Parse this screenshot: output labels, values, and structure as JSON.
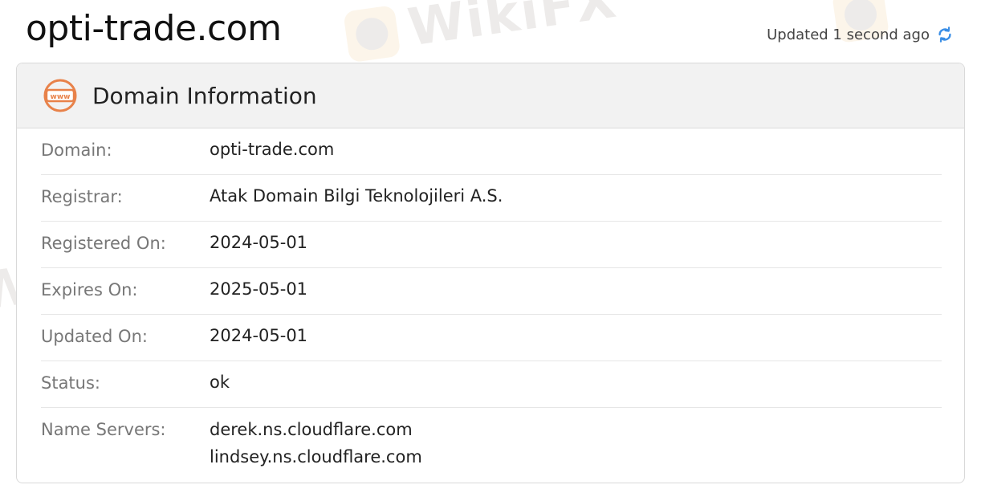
{
  "header": {
    "domain_title": "opti-trade.com",
    "updated_text": "Updated 1 second ago",
    "refresh_icon": "refresh-icon"
  },
  "card": {
    "title": "Domain Information",
    "icon": "www-icon",
    "icon_text": "www",
    "rows": [
      {
        "label": "Domain:",
        "value": "opti-trade.com"
      },
      {
        "label": "Registrar:",
        "value": "Atak Domain Bilgi Teknolojileri A.S."
      },
      {
        "label": "Registered On:",
        "value": "2024-05-01"
      },
      {
        "label": "Expires On:",
        "value": "2025-05-01"
      },
      {
        "label": "Updated On:",
        "value": "2024-05-01"
      },
      {
        "label": "Status:",
        "value": "ok"
      },
      {
        "label": "Name Servers:",
        "values": [
          "derek.ns.cloudflare.com",
          "lindsey.ns.cloudflare.com"
        ]
      }
    ]
  },
  "watermark": {
    "text": "WikiFX"
  },
  "colors": {
    "accent_orange": "#e8824a",
    "refresh_blue": "#3a8ee6",
    "header_bg": "#f2f2f2"
  }
}
